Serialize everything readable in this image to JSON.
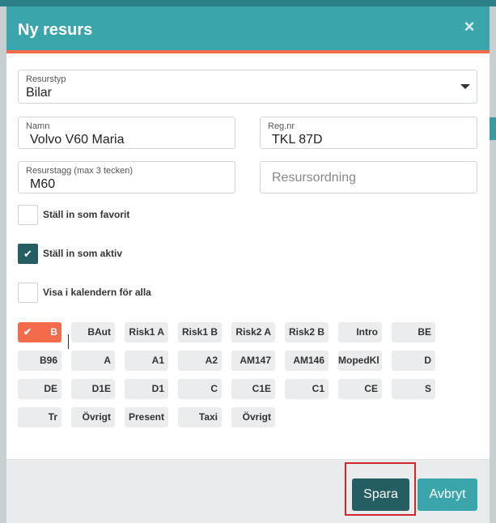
{
  "modal": {
    "title": "Ny resurs",
    "close_icon": "×"
  },
  "form": {
    "resource_type": {
      "label": "Resurstyp",
      "value": "Bilar"
    },
    "name": {
      "label": "Namn",
      "value": "Volvo V60 Maria"
    },
    "reg_nr": {
      "label": "Reg.nr",
      "value": "TKL 87D"
    },
    "tag": {
      "label": "Resurstagg (max 3 tecken)",
      "value": "M60"
    },
    "order": {
      "placeholder": "Resursordning"
    }
  },
  "checkboxes": [
    {
      "label": "Ställ in som favorit",
      "checked": false
    },
    {
      "label": "Ställ in som aktiv",
      "checked": true
    },
    {
      "label": "Visa i kalendern för alla",
      "checked": false
    }
  ],
  "categories": [
    [
      "B",
      "BAut",
      "Risk1 A",
      "Risk1 B",
      "Risk2 A",
      "Risk2 B",
      "Intro",
      "BE"
    ],
    [
      "B96",
      "A",
      "A1",
      "A2",
      "AM147",
      "AM146",
      "MopedKl",
      "D"
    ],
    [
      "DE",
      "D1E",
      "D1",
      "C",
      "C1E",
      "C1",
      "CE",
      "S"
    ],
    [
      "Tr",
      "Övrigt",
      "Present",
      "Taxi",
      "Övrigt"
    ]
  ],
  "selected_category": "B",
  "footer": {
    "save_label": "Spara",
    "cancel_label": "Avbryt"
  },
  "colors": {
    "header": "#3aa5ab",
    "accent": "#f26b4a",
    "primary_dark": "#255e62",
    "highlight": "#d0272d"
  }
}
